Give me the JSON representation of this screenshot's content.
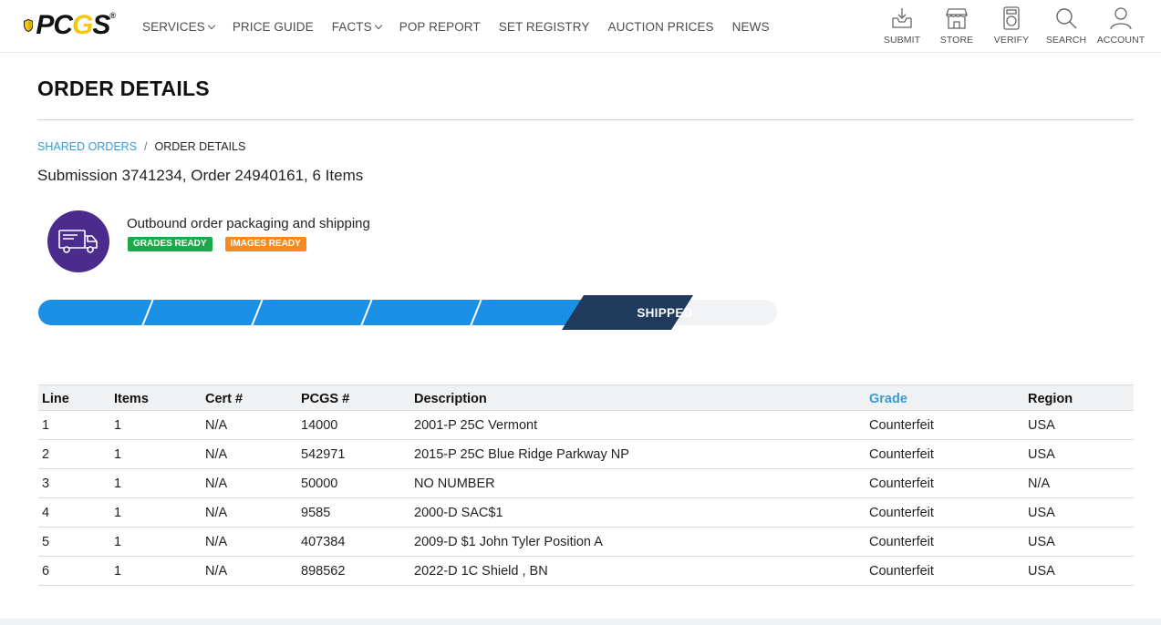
{
  "header": {
    "logo": {
      "text_main": "PC",
      "text_accent": "G",
      "text_end": "S",
      "reg_mark": "®"
    },
    "nav": [
      {
        "label": "SERVICES",
        "has_dropdown": true
      },
      {
        "label": "PRICE GUIDE",
        "has_dropdown": false
      },
      {
        "label": "FACTS",
        "has_dropdown": true
      },
      {
        "label": "POP REPORT",
        "has_dropdown": false
      },
      {
        "label": "SET REGISTRY",
        "has_dropdown": false
      },
      {
        "label": "AUCTION PRICES",
        "has_dropdown": false
      },
      {
        "label": "NEWS",
        "has_dropdown": false
      }
    ],
    "actions": [
      {
        "label": "SUBMIT",
        "icon": "submit-tray-icon"
      },
      {
        "label": "STORE",
        "icon": "store-icon"
      },
      {
        "label": "VERIFY",
        "icon": "verify-slab-icon"
      },
      {
        "label": "SEARCH",
        "icon": "search-icon"
      },
      {
        "label": "ACCOUNT",
        "icon": "account-icon"
      }
    ]
  },
  "page": {
    "title": "ORDER DETAILS",
    "breadcrumb": {
      "parent": "SHARED ORDERS",
      "separator": "/",
      "current": "ORDER DETAILS"
    },
    "summary": "Submission 3741234, Order 24940161, 6 Items"
  },
  "status": {
    "icon": "truck-icon",
    "text": "Outbound order packaging and shipping",
    "badges": [
      {
        "label": "GRADES READY",
        "color": "#1ea84b"
      },
      {
        "label": "IMAGES READY",
        "color": "#f58a1f"
      }
    ]
  },
  "progress": {
    "completed_steps": 5,
    "total_steps": 7,
    "current_label": "SHIPPED",
    "colors": {
      "done": "#1a8fe3",
      "current": "#1f3a5a",
      "pending": "#f2f3f5"
    }
  },
  "table": {
    "columns": [
      "Line",
      "Items",
      "Cert #",
      "PCGS #",
      "Description",
      "Grade",
      "Region"
    ],
    "sortable_column": "Grade",
    "rows": [
      [
        "1",
        "1",
        "N/A",
        "14000",
        "2001-P 25C Vermont",
        "Counterfeit",
        "USA"
      ],
      [
        "2",
        "1",
        "N/A",
        "542971",
        "2015-P 25C Blue Ridge Parkway NP",
        "Counterfeit",
        "USA"
      ],
      [
        "3",
        "1",
        "N/A",
        "50000",
        "NO NUMBER",
        "Counterfeit",
        "N/A"
      ],
      [
        "4",
        "1",
        "N/A",
        "9585",
        "2000-D SAC$1",
        "Counterfeit",
        "USA"
      ],
      [
        "5",
        "1",
        "N/A",
        "407384",
        "2009-D $1 John Tyler Position A",
        "Counterfeit",
        "USA"
      ],
      [
        "6",
        "1",
        "N/A",
        "898562",
        "2022-D 1C Shield , BN",
        "Counterfeit",
        "USA"
      ]
    ]
  },
  "colors": {
    "link": "#3d9ad1",
    "brand_yellow": "#f2c811",
    "status_icon_bg": "#4b2b8e"
  }
}
